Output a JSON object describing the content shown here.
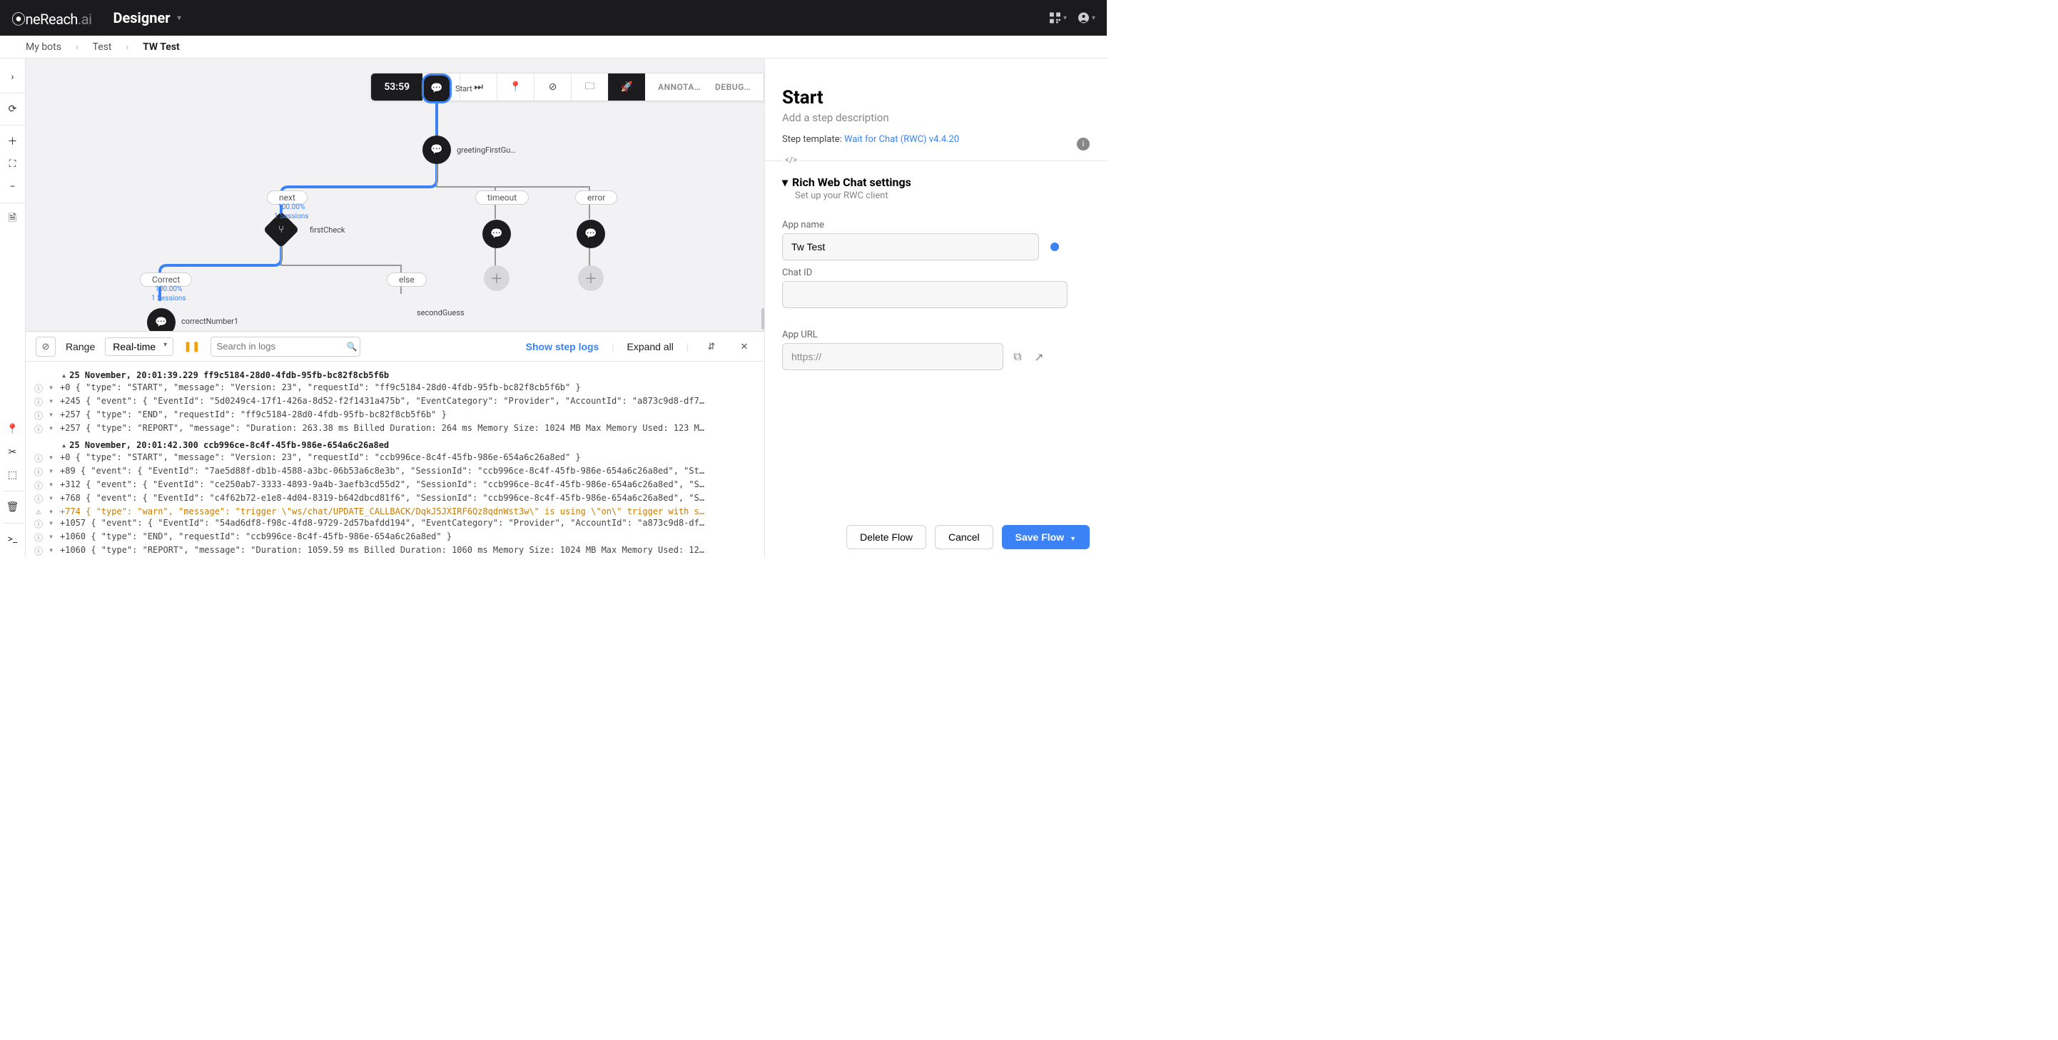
{
  "topbar": {
    "logo_html": "OneReach.ai",
    "app": "Designer"
  },
  "breadcrumbs": [
    "My bots",
    "Test",
    "TW Test"
  ],
  "toolbar": {
    "timer": "53:59",
    "tabs": [
      "ANNOTA…",
      "DEBUG…"
    ]
  },
  "graph": {
    "nodes": {
      "start": {
        "label": "Start"
      },
      "greeting": {
        "label": "greetingFirstGu…"
      },
      "firstCheck": {
        "label": "firstCheck"
      },
      "correctNumber": {
        "label": "correctNumber1"
      },
      "secondGuess": {
        "label": "secondGuess"
      }
    },
    "branches": {
      "next": {
        "label": "next",
        "pct": "100.00%",
        "sessions": "1 Sessions"
      },
      "timeout": {
        "label": "timeout"
      },
      "error": {
        "label": "error"
      },
      "correct": {
        "label": "Correct",
        "pct": "100.00%",
        "sessions": "1 Sessions"
      },
      "else": {
        "label": "else"
      }
    }
  },
  "logs": {
    "range_label": "Range",
    "range_mode": "Real-time",
    "search_placeholder": "Search in logs",
    "show_step": "Show step logs",
    "expand": "Expand all",
    "groups": [
      {
        "ts": "25 November, 20:01:39.229 ff9c5184-28d0-4fdb-95fb-bc82f8cb5f6b",
        "lines": [
          {
            "t": "+0 { \"type\": \"START\", \"message\": \"Version: 23\", \"requestId\": \"ff9c5184-28d0-4fdb-95fb-bc82f8cb5f6b\" }"
          },
          {
            "t": "+245 { \"event\": { \"EventId\": \"5d0249c4-17f1-426a-8d52-f2f1431a475b\", \"EventCategory\": \"Provider\", \"AccountId\": \"a873c9d8-df7…"
          },
          {
            "t": "+257 { \"type\": \"END\", \"requestId\": \"ff9c5184-28d0-4fdb-95fb-bc82f8cb5f6b\" }"
          },
          {
            "t": "+257 { \"type\": \"REPORT\", \"message\": \"Duration: 263.38 ms Billed Duration: 264 ms Memory Size: 1024 MB Max Memory Used: 123 M…"
          }
        ]
      },
      {
        "ts": "25 November, 20:01:42.300 ccb996ce-8c4f-45fb-986e-654a6c26a8ed",
        "lines": [
          {
            "t": "+0 { \"type\": \"START\", \"message\": \"Version: 23\", \"requestId\": \"ccb996ce-8c4f-45fb-986e-654a6c26a8ed\" }"
          },
          {
            "t": "+89 { \"event\": { \"EventId\": \"7ae5d88f-db1b-4588-a3bc-06b53a6c8e3b\", \"SessionId\": \"ccb996ce-8c4f-45fb-986e-654a6c26a8ed\", \"St…"
          },
          {
            "t": "+312 { \"event\": { \"EventId\": \"ce250ab7-3333-4893-9a4b-3aefb3cd55d2\", \"SessionId\": \"ccb996ce-8c4f-45fb-986e-654a6c26a8ed\", \"S…"
          },
          {
            "t": "+768 { \"event\": { \"EventId\": \"c4f62b72-e1e8-4d04-8319-b642dbcd81f6\", \"SessionId\": \"ccb996ce-8c4f-45fb-986e-654a6c26a8ed\", \"S…"
          },
          {
            "t": "+774 { \"type\": \"warn\", \"message\": \"trigger \\\"ws/chat/UPDATE_CALLBACK/DqkJ5JXIRF6Qz8qdnWst3w\\\" is using \\\"on\\\" trigger with s…",
            "warn": true
          },
          {
            "t": "+1057 { \"event\": { \"EventId\": \"54ad6df8-f98c-4fd8-9729-2d57bafdd194\", \"EventCategory\": \"Provider\", \"AccountId\": \"a873c9d8-df…"
          },
          {
            "t": "+1060 { \"type\": \"END\", \"requestId\": \"ccb996ce-8c4f-45fb-986e-654a6c26a8ed\" }"
          },
          {
            "t": "+1060 { \"type\": \"REPORT\", \"message\": \"Duration: 1059.59 ms Billed Duration: 1060 ms Memory Size: 1024 MB Max Memory Used: 12…"
          }
        ]
      }
    ]
  },
  "panel": {
    "title": "Start",
    "desc_placeholder": "Add a step description",
    "tmpl_label": "Step template:",
    "tmpl_name": "Wait for Chat (RWC) v4.4.20",
    "code_tag": "</>",
    "section": "Rich Web Chat settings",
    "section_sub": "Set up your RWC client",
    "fields": {
      "app_name_label": "App name",
      "app_name_value": "Tw Test",
      "chat_id_label": "Chat ID",
      "chat_id_value": "",
      "app_url_label": "App URL",
      "app_url_value": "https://"
    },
    "buttons": {
      "delete": "Delete Flow",
      "cancel": "Cancel",
      "save": "Save Flow"
    }
  }
}
